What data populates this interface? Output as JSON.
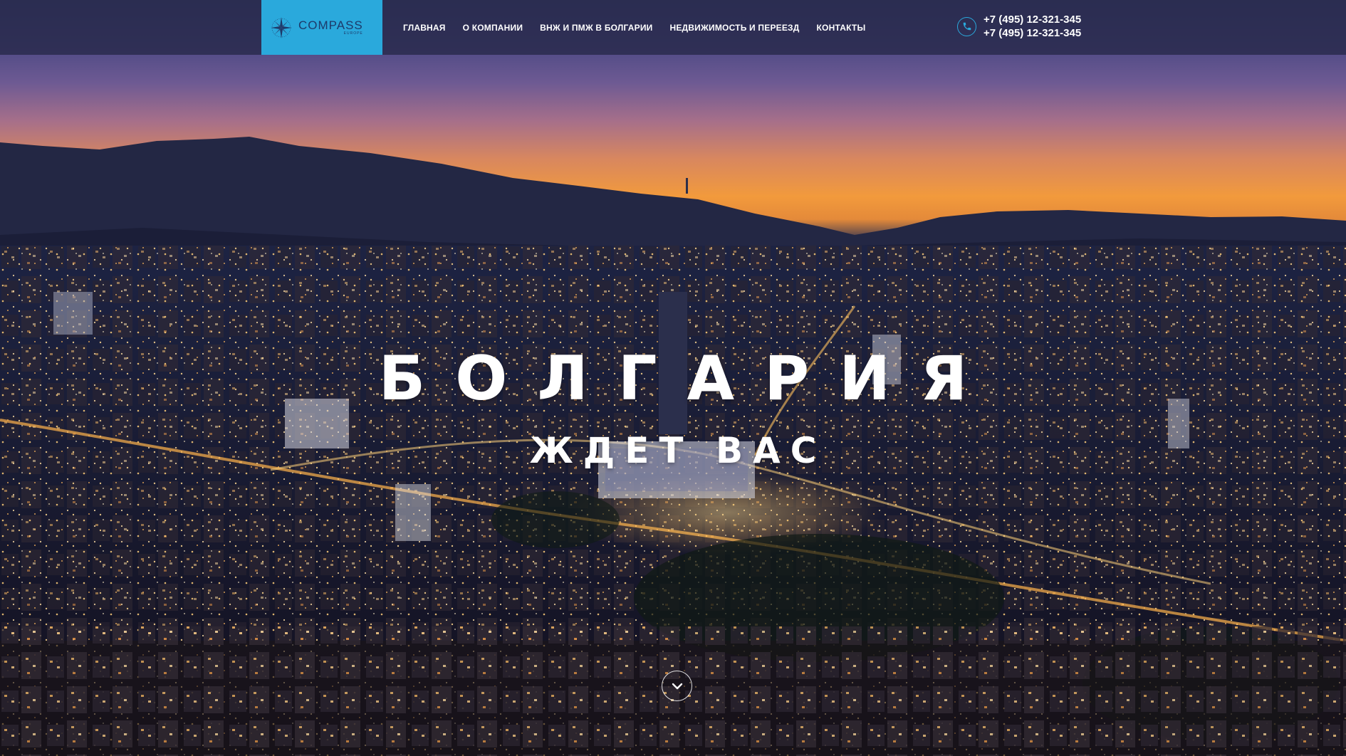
{
  "header": {
    "logo": {
      "text": "COMPASS",
      "subtext": "EUROPE",
      "icon": "compass-star-icon",
      "background": "#2aa9dc"
    },
    "nav": [
      {
        "label": "ГЛАВНАЯ"
      },
      {
        "label": "О КОМПАНИИ"
      },
      {
        "label": "ВНЖ И ПМЖ В БОЛГАРИИ"
      },
      {
        "label": "НЕДВИЖИМОСТЬ И ПЕРЕЕЗД"
      },
      {
        "label": "КОНТАКТЫ"
      }
    ],
    "phone_icon": "phone-icon",
    "phones": [
      "+7 (495) 12-321-345",
      "+7 (495) 12-321-345"
    ]
  },
  "hero": {
    "title": "БОЛГАРИЯ",
    "subtitle": "ЖДЕТ ВАС",
    "scroll_icon": "chevron-down-icon"
  },
  "colors": {
    "accent": "#2aa9dc",
    "navbar": "#262848",
    "text": "#ffffff"
  }
}
